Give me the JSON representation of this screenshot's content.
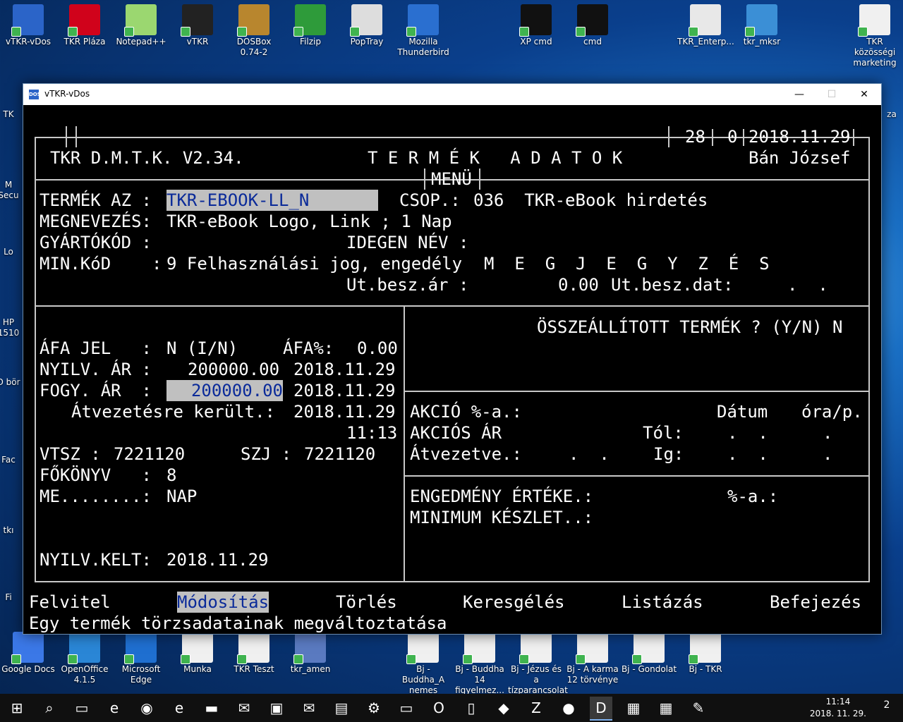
{
  "desktop": {
    "top_icons": [
      {
        "label": "vTKR-vDos",
        "icon": "dos-icon",
        "color": "#2b64c8"
      },
      {
        "label": "TKR Pláza",
        "icon": "opera-icon",
        "color": "#d0021b"
      },
      {
        "label": "Notepad++",
        "icon": "notepad-icon",
        "color": "#9bd770"
      },
      {
        "label": "vTKR",
        "icon": "console-icon",
        "color": "#222222"
      },
      {
        "label": "DOSBox 0.74-2",
        "icon": "dosbox-icon",
        "color": "#b8862e"
      },
      {
        "label": "Filzip",
        "icon": "zip-icon",
        "color": "#2e9b3a"
      },
      {
        "label": "PopTray",
        "icon": "mail-icon",
        "color": "#dddddd"
      },
      {
        "label": "Mozilla Thunderbird",
        "icon": "thunderbird-icon",
        "color": "#2a6fd0"
      },
      {
        "label": "XP cmd",
        "icon": "cmd-icon",
        "color": "#111111"
      },
      {
        "label": "cmd",
        "icon": "cmd-icon",
        "color": "#111111"
      },
      {
        "label": "TKR_Enterp...",
        "icon": "tkr-icon",
        "color": "#e8e8e8"
      },
      {
        "label": "tkr_mksr",
        "icon": "tkr-icon",
        "color": "#3b8fd6"
      },
      {
        "label": "TKR közösségi marketing",
        "icon": "document-icon",
        "color": "#f0f0f0"
      }
    ],
    "left_partial": [
      "TK",
      "M Secu",
      "Lo",
      "HP 1510",
      "O bör",
      "Fac",
      "tkı",
      "Fi"
    ],
    "right_partial": [
      "za"
    ],
    "bottom_icons": [
      {
        "label": "Google Docs",
        "icon": "docs-icon",
        "color": "#3b78e7"
      },
      {
        "label": "OpenOffice 4.1.5",
        "icon": "openoffice-icon",
        "color": "#2a86d6"
      },
      {
        "label": "Microsoft Edge",
        "icon": "edge-icon",
        "color": "#1f6fd0"
      },
      {
        "label": "Munka",
        "icon": "document-icon",
        "color": "#f0f0f0"
      },
      {
        "label": "TKR Teszt",
        "icon": "document-icon",
        "color": "#f0f0f0"
      },
      {
        "label": "tkr_amen",
        "icon": "building-icon",
        "color": "#5a7ac0"
      },
      {
        "label": "Bj - Buddha_A nemes nyol...",
        "icon": "document-icon",
        "color": "#f0f0f0"
      },
      {
        "label": "Bj - Buddha 14 figyelmez...",
        "icon": "document-icon",
        "color": "#f0f0f0"
      },
      {
        "label": "Bj - Jézus és a tízparancsolat",
        "icon": "document-icon",
        "color": "#f0f0f0"
      },
      {
        "label": "Bj - A karma 12 törvénye",
        "icon": "document-icon",
        "color": "#f0f0f0"
      },
      {
        "label": "Bj - Gondolat",
        "icon": "document-icon",
        "color": "#f0f0f0"
      },
      {
        "label": "Bj - TKR",
        "icon": "document-icon",
        "color": "#f0f0f0"
      }
    ]
  },
  "window": {
    "title": "vTKR-vDos",
    "minimize": "—",
    "maximize": "☐",
    "close": "✕"
  },
  "dos": {
    "header": {
      "day": "28",
      "counter": "0",
      "date": "2018.11.29",
      "app": "TKR D.M.T.K. V2.34.",
      "screen_title": "T E R M É K   A D A T O K",
      "user": "Bán József",
      "menu_tag": "MENÜ"
    },
    "product": {
      "id_label": "TERMÉK AZ :",
      "id_value": "TKR-EBOOK-LL_N",
      "group_label": "CSOP.:",
      "group_value": "036  TKR-eBook hirdetés",
      "name_label": "MEGNEVEZÉS:",
      "name_value": "TKR-eBook Logo, Link ; 1 Nap",
      "maker_label": "GYÁRTÓKÓD :",
      "foreign_label": "IDEGEN NÉV :",
      "min_label": "MIN.KóD    :",
      "min_value": "9 Felhasználási jog, engedély",
      "note_label": "M  E  G  J  E  G  Y  Z  É  S",
      "lastprice_label": "Ut.besz.ár :",
      "lastprice_value": "0.00",
      "lastdate_label": "Ut.besz.dat:",
      "lastdate_value": ".  ."
    },
    "left": {
      "vat_label": "ÁFA JEL   :",
      "vat_value": "N (I/N)",
      "vatpct_label": "ÁFA%:",
      "vatpct_value": "0.00",
      "book_label": "NYILV. ÁR :",
      "book_value": "200000.00",
      "book_date": "2018.11.29",
      "sale_label": "FOGY. ÁR  :",
      "sale_value": "200000.00",
      "sale_date": "2018.11.29",
      "transfer_label": "Átvezetésre került.:",
      "transfer_date": "2018.11.29",
      "transfer_time": "11:13",
      "vtsz_label": "VTSZ :",
      "vtsz_value": "7221120",
      "szj_label": "SZJ :",
      "szj_value": "7221120",
      "ledger_label": "FŐKÖNYV   :",
      "ledger_value": "8",
      "unit_label": "ME........:",
      "unit_value": "NAP",
      "created_label": "NYILV.KELT:",
      "created_value": "2018.11.29"
    },
    "right": {
      "assembled": "ÖSSZEÁLLÍTOTT TERMÉK ? (Y/N) N",
      "action_pct": "AKCIÓ %-a.:",
      "date_hdr": "Dátum",
      "time_hdr": "óra/p.",
      "action_price": "AKCIÓS ÁR",
      "from_label": "Tól:",
      "from_value": ".  .",
      "from_time": ".",
      "transferred": "Átvezetve.:",
      "transferred_value": ".  .",
      "to_label": "Ig:",
      "to_value": ".  .",
      "to_time": ".",
      "discount": "ENGEDMÉNY ÉRTÉKE.:",
      "discount_pct": "%-a.:",
      "min_stock": "MINIMUM KÉSZLET..:"
    },
    "menu": [
      {
        "label": "Felvitel"
      },
      {
        "label": "Módosítás",
        "selected": true
      },
      {
        "label": "Törlés"
      },
      {
        "label": "Keresgélés"
      },
      {
        "label": "Listázás"
      },
      {
        "label": "Befejezés"
      }
    ],
    "status": "Egy termék törzsadatainak megváltoztatása"
  },
  "taskbar": {
    "items": [
      "start-icon",
      "search-icon",
      "task-view-icon",
      "edge-icon",
      "chrome-icon",
      "ie-icon",
      "explorer-icon",
      "outlook-icon",
      "store-icon",
      "mail-icon",
      "remote-icon",
      "settings-icon",
      "console-icon",
      "opera-icon",
      "file-icon",
      "crystal-icon",
      "filezilla-icon",
      "firefox-icon",
      "vdos-icon",
      "dosbox-icon",
      "calculator-icon",
      "paint-icon"
    ],
    "time": "11:14",
    "date": "2018. 11. 29.",
    "notifications": "2"
  }
}
